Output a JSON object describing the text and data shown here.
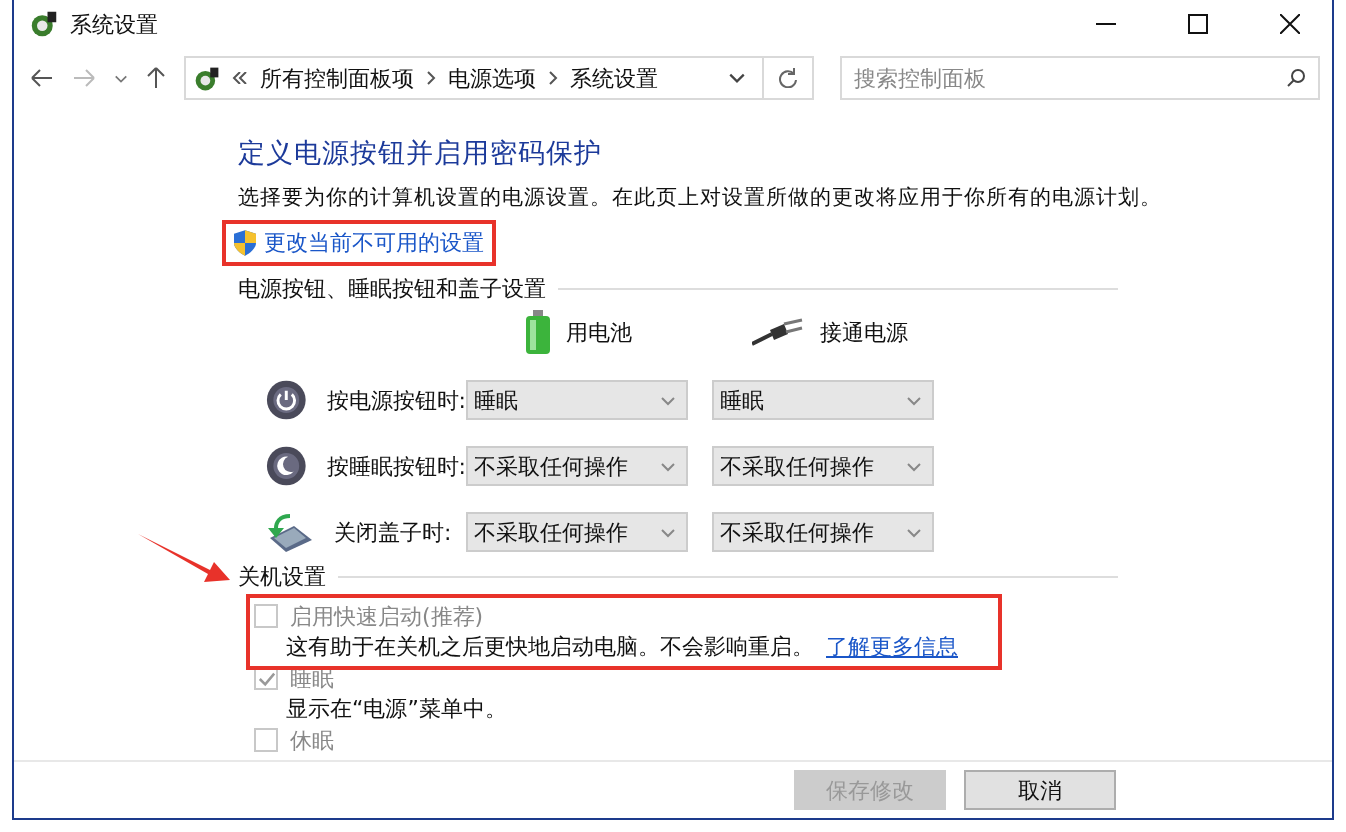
{
  "window": {
    "title": "系统设置"
  },
  "address_bar": {
    "breadcrumbs": [
      "所有控制面板项",
      "电源选项",
      "系统设置"
    ]
  },
  "search": {
    "placeholder": "搜索控制面板"
  },
  "heading": "定义电源按钮并启用密码保护",
  "description": "选择要为你的计算机设置的电源设置。在此页上对设置所做的更改将应用于你所有的电源计划。",
  "admin_link": {
    "label": "更改当前不可用的设置",
    "highlighted": true
  },
  "button_section": {
    "title": "电源按钮、睡眠按钮和盖子设置",
    "columns": [
      {
        "kind": "battery",
        "label": "用电池"
      },
      {
        "kind": "plug",
        "label": "接通电源"
      }
    ],
    "rows": [
      {
        "kind": "power",
        "label": "按电源按钮时:",
        "values": [
          "睡眠",
          "睡眠"
        ]
      },
      {
        "kind": "sleep",
        "label": "按睡眠按钮时:",
        "values": [
          "不采取任何操作",
          "不采取任何操作"
        ]
      },
      {
        "kind": "lid",
        "label": "关闭盖子时:",
        "values": [
          "不采取任何操作",
          "不采取任何操作"
        ]
      }
    ]
  },
  "shutdown_section": {
    "title": "关机设置",
    "options": [
      {
        "label": "启用快速启动(推荐)",
        "checked": false,
        "disabled": true,
        "highlighted": true,
        "description": "这有助于在关机之后更快地启动电脑。不会影响重启。",
        "link": "了解更多信息"
      },
      {
        "label": "睡眠",
        "checked": true,
        "disabled": true,
        "highlighted": false,
        "description": "显示在“电源”菜单中。"
      },
      {
        "label": "休眠",
        "checked": false,
        "disabled": true,
        "highlighted": false
      }
    ]
  },
  "buttons": [
    {
      "label": "保存修改",
      "disabled": true
    },
    {
      "label": "取消",
      "disabled": false
    }
  ]
}
